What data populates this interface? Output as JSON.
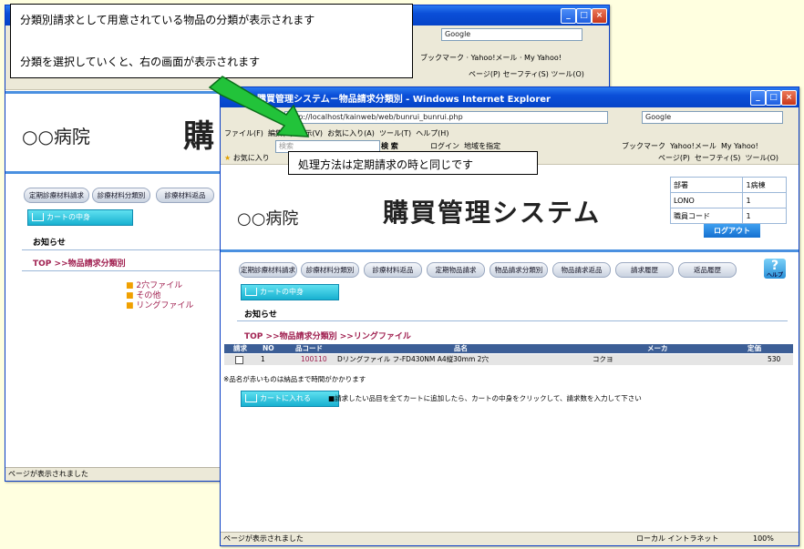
{
  "back_window": {
    "hospital": "○○病院",
    "logo_partial": "購",
    "nav": [
      "定期診療材料請求",
      "診療材料分類別",
      "診療材料返品"
    ],
    "cart_button": "カートの中身",
    "notice": "お知らせ",
    "crumb_top": "TOP",
    "crumb_current": ">>物品請求分類別",
    "categories": [
      "2穴ファイル",
      "その他",
      "リングファイル"
    ],
    "status": "ページが表示されました"
  },
  "front_window": {
    "title": "購買管理システム－物品請求分類別 - Windows Internet Explorer",
    "title_prefix_cut": "購買管理システム－物品請求分類別 - Windows Internet Explorer",
    "address": "http://localhost/kainweb/web/bunrui_bunrui.php",
    "search_engine": "Google",
    "menu": [
      "ファイル(F)",
      "編集(E)",
      "表示(V)",
      "お気に入り(A)",
      "ツール(T)",
      "ヘルプ(H)"
    ],
    "search_label": "検 索",
    "search_placeholder": "検索",
    "toolbar_items": [
      "ログイン",
      "地域を指定",
      "ブックマーク",
      "Yahoo!メール",
      "My Yahoo!"
    ],
    "fav_label": "お気に入り",
    "page_tools": [
      "ページ(P)",
      "セーフティ(S)",
      "ツール(O)"
    ],
    "hospital": "○○病院",
    "logo": "購買管理システム",
    "info": [
      {
        "label": "部署",
        "value": "1病棟"
      },
      {
        "label": "LONO",
        "value": "1"
      },
      {
        "label": "職員コード",
        "value": "1"
      }
    ],
    "logout": "ログアウト",
    "nav": [
      "定期診療材料請求",
      "診療材料分類別",
      "診療材料返品",
      "定期物品請求",
      "物品請求分類別",
      "物品請求返品",
      "請求履歴",
      "返品履歴"
    ],
    "help": "ヘルプ",
    "cart_button": "カートの中身",
    "notice": "お知らせ",
    "crumb_top": "TOP",
    "crumb_path": ">>物品請求分類別 >>リングファイル",
    "columns": [
      "請求",
      "NO",
      "品コード",
      "品名",
      "メーカ",
      "定価"
    ],
    "rows": [
      {
        "no": "1",
        "code": "100110",
        "name": "Dリングファイル フ-FD430NM A4縦30mm 2穴",
        "maker": "コクヨ",
        "price": "530"
      }
    ],
    "remark": "※品名が赤いものは納品まで時間がかかります",
    "add_cart": "カートに入れる",
    "instruction": "■請求したい品目を全てカートに追加したら、カートの中身をクリックして、請求数を入力して下さい",
    "status": "ページが表示されました",
    "zone": "ローカル イントラネット",
    "zoom": "100%"
  },
  "back_toolbar": {
    "search_engine": "Google",
    "items": [
      "ブックマーク",
      "Yahoo!メール",
      "My Yahoo!"
    ],
    "page_tools": [
      "ページ(P)",
      "セーフティ(S)",
      "ツール(O)"
    ]
  },
  "callouts": {
    "top_line1": "分類別請求として用意されている物品の分類が表示されます",
    "top_line2": "分類を選択していくと、右の画面が表示されます",
    "middle": "処理方法は定期請求の時と同じです"
  }
}
